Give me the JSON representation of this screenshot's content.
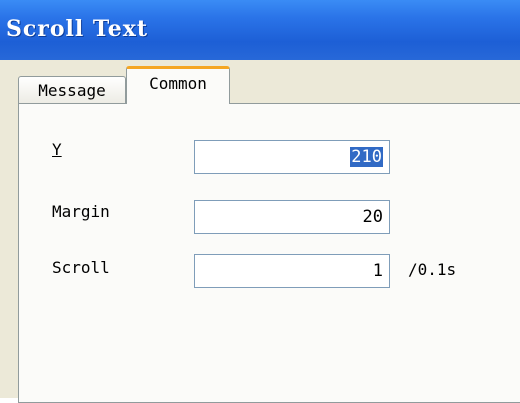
{
  "window": {
    "title": "Scroll Text"
  },
  "tabs": [
    {
      "label": "Message",
      "active": false
    },
    {
      "label": "Common",
      "active": true
    }
  ],
  "fields": {
    "y": {
      "label": "Y",
      "value": "210",
      "selected": true
    },
    "margin": {
      "label": "Margin",
      "value": "20"
    },
    "scroll": {
      "label": "Scroll",
      "value": "1",
      "unit": "/0.1s"
    }
  },
  "colors": {
    "titlebar": "#2a73e8",
    "active_tab_accent": "#f5a623",
    "selection": "#316ac5"
  }
}
